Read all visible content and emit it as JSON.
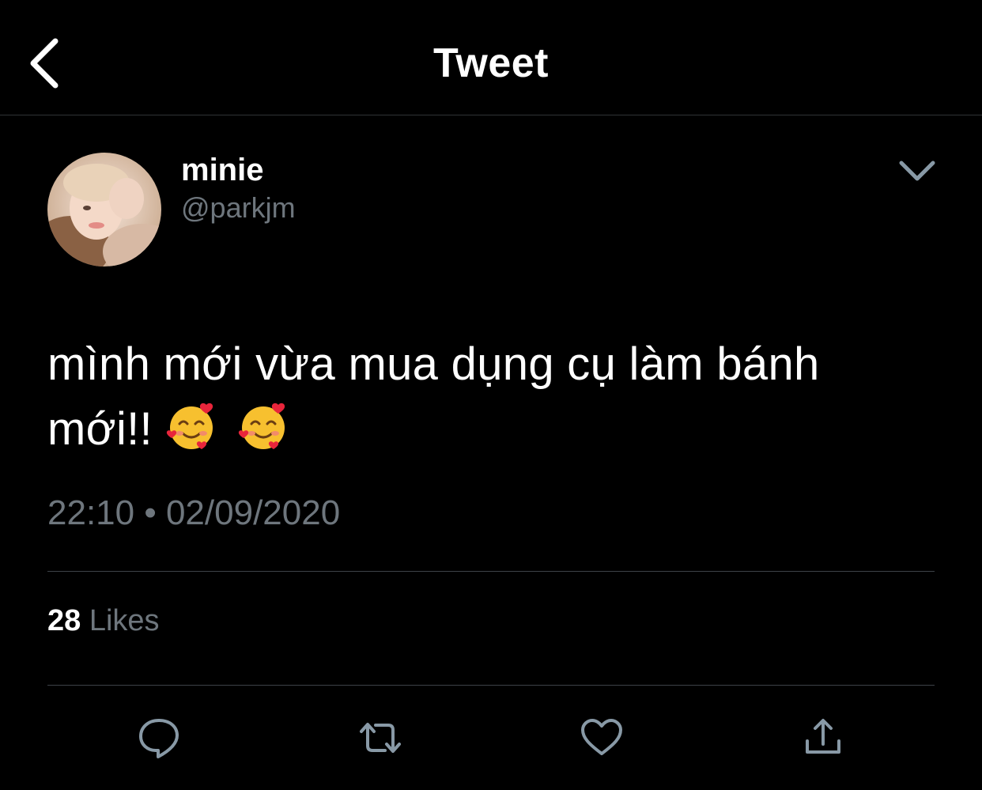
{
  "header": {
    "title": "Tweet",
    "back_icon": "chevron-left-icon"
  },
  "author": {
    "display_name": "minie",
    "handle": "@parkjm",
    "avatar": "profile-photo"
  },
  "tweet": {
    "text": "mình mới vừa mua dụng cụ làm bánh mới!!",
    "emojis": [
      "smiling-face-with-hearts-emoji",
      "smiling-face-with-hearts-emoji"
    ],
    "timestamp": "22:10 • 02/09/2020"
  },
  "stats": {
    "likes_count": "28",
    "likes_label": "Likes"
  },
  "actions": [
    {
      "name": "reply",
      "icon": "reply-icon"
    },
    {
      "name": "retweet",
      "icon": "retweet-icon"
    },
    {
      "name": "like",
      "icon": "heart-icon"
    },
    {
      "name": "share",
      "icon": "share-icon"
    }
  ],
  "colors": {
    "background": "#000000",
    "primary_text": "#ffffff",
    "secondary_text": "#6e767d",
    "icon_color": "#8899a6",
    "divider": "#3d4248"
  }
}
